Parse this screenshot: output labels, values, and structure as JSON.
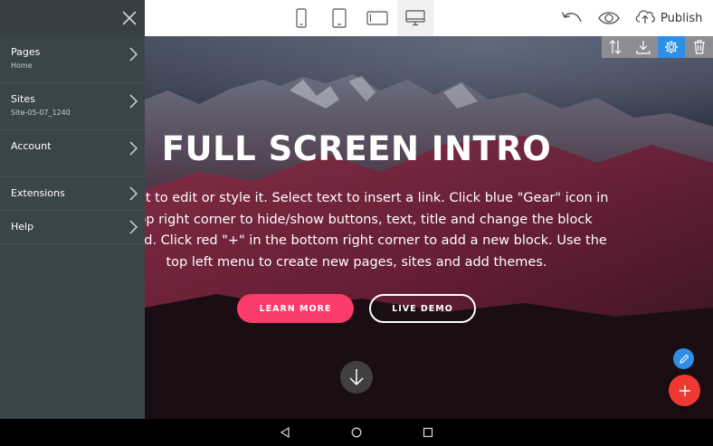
{
  "toolbar": {
    "devices": [
      {
        "name": "phone",
        "icon": "phone-icon",
        "active": false
      },
      {
        "name": "tablet",
        "icon": "tablet-icon",
        "active": false
      },
      {
        "name": "tablet-landscape",
        "icon": "tablet-landscape-icon",
        "active": false
      },
      {
        "name": "desktop",
        "icon": "desktop-icon",
        "active": true
      }
    ],
    "undo_icon": "undo-icon",
    "preview_icon": "eye-icon",
    "publish_icon": "cloud-upload-icon",
    "publish_label": "Publish"
  },
  "sidebar": {
    "close_icon": "close-icon",
    "items": [
      {
        "label": "Pages",
        "sub": "Home"
      },
      {
        "label": "Sites",
        "sub": "Site-05-07_1240"
      },
      {
        "label": "Account",
        "sub": ""
      },
      {
        "label": "Extensions",
        "sub": ""
      },
      {
        "label": "Help",
        "sub": ""
      }
    ]
  },
  "hero": {
    "title": "FULL SCREEN INTRO",
    "text_lines": [
      "ny text to edit or style it. Select text to insert a link. Click blue \"Gear\" icon in",
      "e top right corner to hide/show buttons, text, title and change the block",
      "ground. Click red \"+\" in the bottom right corner to add a new block. Use the",
      "top left menu to create new pages, sites and add themes."
    ],
    "primary_button": "LEARN MORE",
    "secondary_button": "LIVE DEMO",
    "scroll_icon": "arrow-down-icon"
  },
  "block_tools": [
    {
      "icon": "move-icon",
      "active": false
    },
    {
      "icon": "download-icon",
      "active": false
    },
    {
      "icon": "gear-icon",
      "active": true
    },
    {
      "icon": "trash-icon",
      "active": false
    }
  ],
  "fabs": {
    "edit_icon": "pencil-icon",
    "add_icon": "plus-icon"
  },
  "colors": {
    "accent_blue": "#2f8fe6",
    "accent_red": "#f03a31",
    "button_pink": "#fc3d6c",
    "sidebar_bg": "#3a454b"
  },
  "android_nav": {
    "back_icon": "back-triangle-icon",
    "home_icon": "home-circle-icon",
    "recents_icon": "recents-square-icon"
  }
}
